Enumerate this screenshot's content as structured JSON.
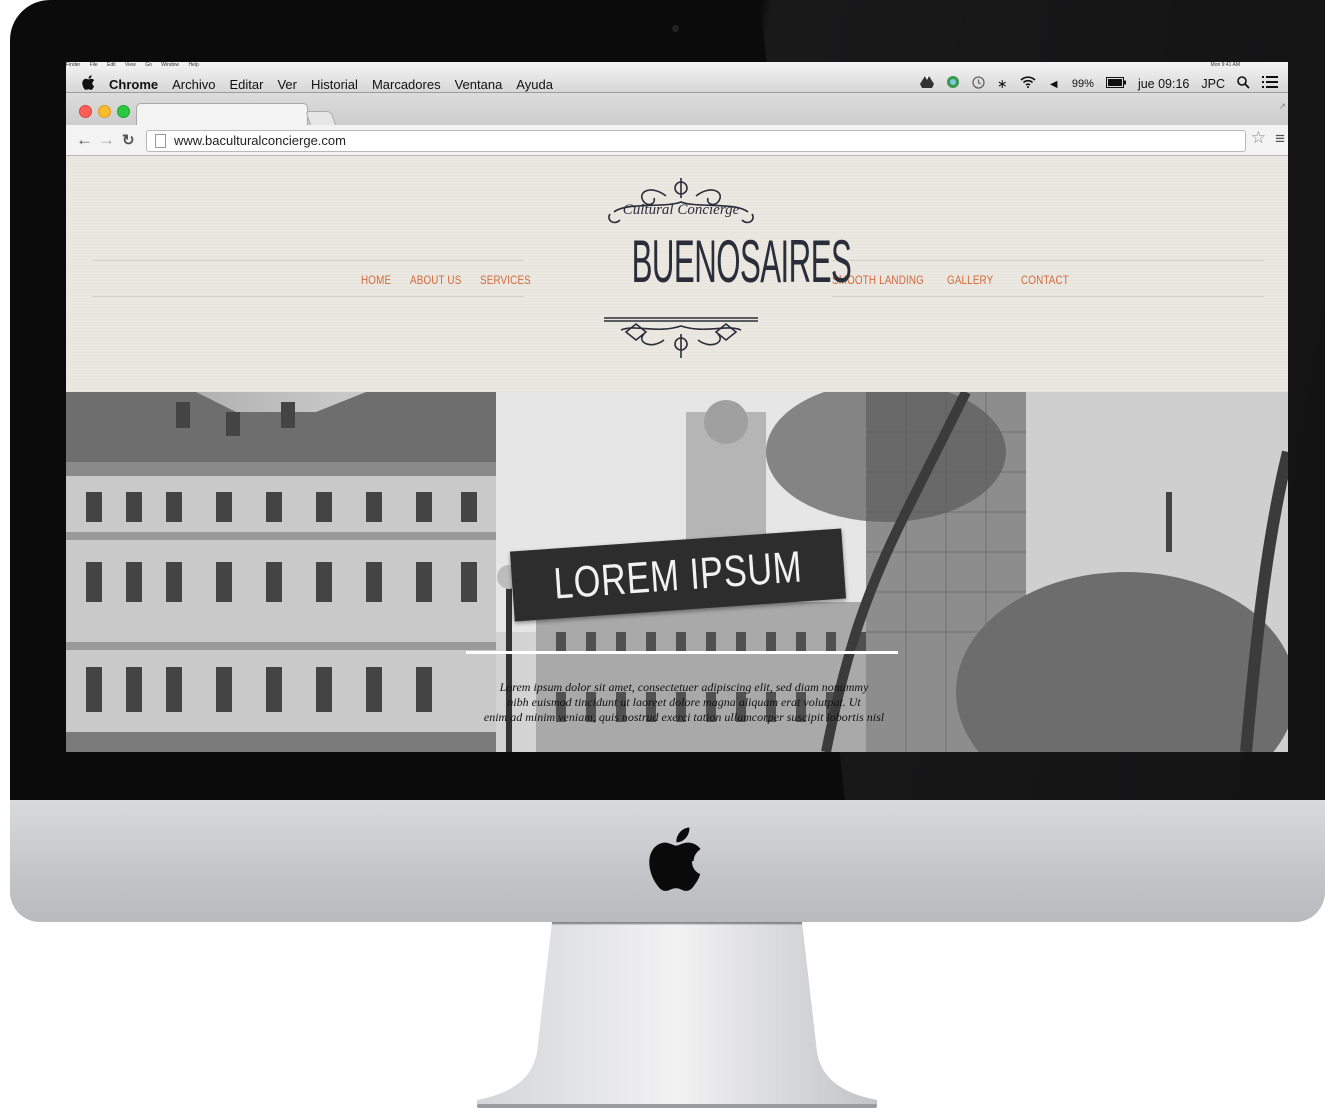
{
  "menubar": {
    "apple_icon": "apple-icon",
    "app_name": "Chrome",
    "menus": [
      "Archivo",
      "Editar",
      "Ver",
      "Historial",
      "Marcadores",
      "Ventana",
      "Ayuda"
    ],
    "battery": "99%",
    "clock": "jue 09:16",
    "user": "JPC",
    "ghost_menus": [
      "Finder",
      "File",
      "Edit",
      "View",
      "Go",
      "Window",
      "Help"
    ],
    "ghost_clock": "Mon 9:41 AM"
  },
  "browser": {
    "url": "www.baculturalconcierge.com"
  },
  "site": {
    "logo_script": "Cultural Concierge",
    "logo_title": "BUENOSAIRES",
    "nav_left": [
      "HOME",
      "ABOUT US",
      "SERVICES"
    ],
    "nav_right": [
      "SMOOTH LANDING",
      "GALLERY",
      "CONTACT"
    ],
    "accent_color": "#d2693b",
    "hero": {
      "title": "LOREM IPSUM",
      "text_lines": [
        "Lorem ipsum dolor sit amet, consectetuer adipiscing elit, sed diam nonummy",
        "nibh euismod tincidunt ut laoreet dolore magna aliquam erat volutpat. Ut",
        "enim ad minim veniam, quis nostrud exerci tation ullamcorper suscipit lobortis nisl"
      ]
    }
  }
}
